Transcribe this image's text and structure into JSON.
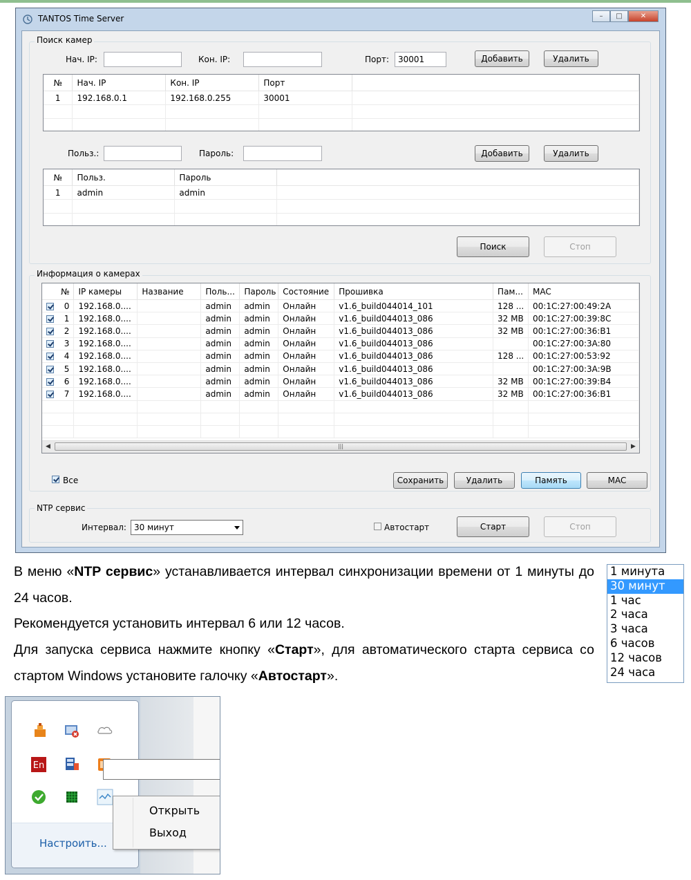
{
  "window": {
    "title": "TANTOS Time Server",
    "controls": {
      "minimize": "–",
      "maximize": "□",
      "close": "✕"
    }
  },
  "camera_search": {
    "group_label": "Поиск камер",
    "start_ip_label": "Нач. IP:",
    "start_ip_value": "",
    "end_ip_label": "Кон. IP:",
    "end_ip_value": "",
    "port_label": "Порт:",
    "port_value": "30001",
    "add_button": "Добавить",
    "delete_button": "Удалить",
    "ranges_table": {
      "headers": [
        "№",
        "Нач. IP",
        "Кон. IP",
        "Порт"
      ],
      "rows": [
        [
          "1",
          "192.168.0.1",
          "192.168.0.255",
          "30001"
        ]
      ]
    },
    "user_label": "Польз.:",
    "user_value": "",
    "password_label": "Пароль:",
    "password_value": "",
    "add_button_2": "Добавить",
    "delete_button_2": "Удалить",
    "users_table": {
      "headers": [
        "№",
        "Польз.",
        "Пароль"
      ],
      "rows": [
        [
          "1",
          "admin",
          "admin"
        ]
      ]
    },
    "search_button": "Поиск",
    "stop_button": "Стоп"
  },
  "camera_info": {
    "group_label": "Информация о камерах",
    "headers": [
      "№",
      "IP камеры",
      "Название",
      "Поль...",
      "Пароль",
      "Состояние",
      "Прошивка",
      "Пам...",
      "MAC"
    ],
    "rows": [
      [
        "0",
        "192.168.0....",
        "",
        "admin",
        "admin",
        "Онлайн",
        "v1.6_build044014_101",
        "128 ...",
        "00:1C:27:00:49:2A"
      ],
      [
        "1",
        "192.168.0....",
        "",
        "admin",
        "admin",
        "Онлайн",
        "v1.6_build044013_086",
        "32 MB",
        "00:1C:27:00:39:8C"
      ],
      [
        "2",
        "192.168.0....",
        "",
        "admin",
        "admin",
        "Онлайн",
        "v1.6_build044013_086",
        "32 MB",
        "00:1C:27:00:36:B1"
      ],
      [
        "3",
        "192.168.0....",
        "",
        "admin",
        "admin",
        "Онлайн",
        "v1.6_build044013_086",
        "",
        "00:1C:27:00:3A:80"
      ],
      [
        "4",
        "192.168.0....",
        "",
        "admin",
        "admin",
        "Онлайн",
        "v1.6_build044013_086",
        "128 ...",
        "00:1C:27:00:53:92"
      ],
      [
        "5",
        "192.168.0....",
        "",
        "admin",
        "admin",
        "Онлайн",
        "v1.6_build044013_086",
        "",
        "00:1C:27:00:3A:9B"
      ],
      [
        "6",
        "192.168.0....",
        "",
        "admin",
        "admin",
        "Онлайн",
        "v1.6_build044013_086",
        "32 MB",
        "00:1C:27:00:39:B4"
      ],
      [
        "7",
        "192.168.0....",
        "",
        "admin",
        "admin",
        "Онлайн",
        "v1.6_build044013_086",
        "32 MB",
        "00:1C:27:00:36:B1"
      ]
    ],
    "all_checkbox_label": "Все",
    "save_button": "Сохранить",
    "delete_button": "Удалить",
    "memory_button": "Память",
    "mac_button": "MAC"
  },
  "ntp": {
    "group_label": "NTP сервис",
    "interval_label": "Интервал:",
    "interval_value": "30 минут",
    "autostart_label": "Автостарт",
    "start_button": "Старт",
    "stop_button": "Стоп"
  },
  "document": {
    "p1_a": "В меню «",
    "p1_bold": "NTP сервис",
    "p1_b": "» устанавливается интервал синхронизации времени от 1 минуты до 24 часов.",
    "p2": "Рекомендуется установить интервал 6 или 12 часов.",
    "p3_a": "Для запуска сервиса нажмите кнопку «",
    "p3_bold1": "Старт",
    "p3_b": "», для автоматического старта сервиса со стартом Windows установите галочку «",
    "p3_bold2": "Автостарт",
    "p3_c": "»."
  },
  "interval_options": [
    "1  минута",
    "30 минут",
    "1  час",
    "2 часа",
    "3 часа",
    "6 часов",
    "12 часов",
    "24 часа"
  ],
  "interval_selected_index": 1,
  "tray": {
    "configure_link": "Настроить...",
    "menu": {
      "open": "Открыть",
      "exit": "Выход"
    },
    "icons": [
      "tantos-icon",
      "network-error-icon",
      "cloud-icon",
      "language-en-icon",
      "display-icon",
      "orange-app-icon",
      "green-check-icon",
      "green-grid-icon",
      "time-server-icon"
    ]
  },
  "colors": {
    "window_frame": "#c4d6ea",
    "selection": "#3399ff",
    "link": "#1b5ea8"
  }
}
